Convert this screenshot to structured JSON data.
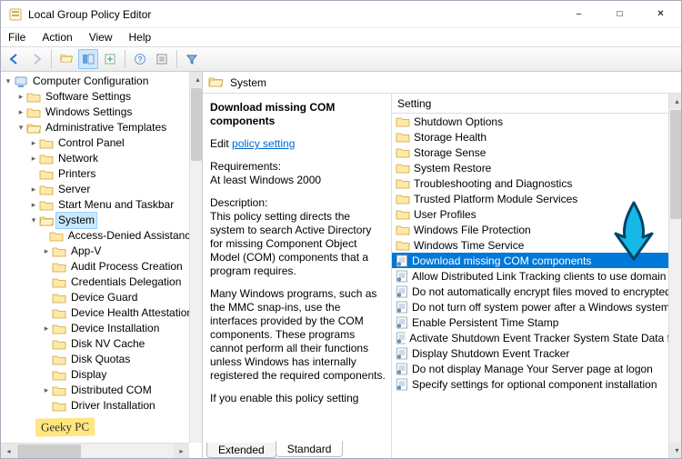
{
  "window": {
    "title": "Local Group Policy Editor"
  },
  "menubar": [
    "File",
    "Action",
    "View",
    "Help"
  ],
  "tree": {
    "root": "Computer Configuration",
    "children": [
      {
        "label": "Software Settings",
        "expand": "closed"
      },
      {
        "label": "Windows Settings",
        "expand": "closed"
      },
      {
        "label": "Administrative Templates",
        "expand": "open",
        "children": [
          {
            "label": "Control Panel",
            "expand": "closed"
          },
          {
            "label": "Network",
            "expand": "closed"
          },
          {
            "label": "Printers",
            "expand": "none"
          },
          {
            "label": "Server",
            "expand": "closed"
          },
          {
            "label": "Start Menu and Taskbar",
            "expand": "closed"
          },
          {
            "label": "System",
            "expand": "open",
            "selected": true,
            "children": [
              {
                "label": "Access-Denied Assistance"
              },
              {
                "label": "App-V",
                "expand": "closed"
              },
              {
                "label": "Audit Process Creation"
              },
              {
                "label": "Credentials Delegation"
              },
              {
                "label": "Device Guard"
              },
              {
                "label": "Device Health Attestation"
              },
              {
                "label": "Device Installation",
                "expand": "closed"
              },
              {
                "label": "Disk NV Cache"
              },
              {
                "label": "Disk Quotas"
              },
              {
                "label": "Display"
              },
              {
                "label": "Distributed COM",
                "expand": "closed"
              },
              {
                "label": "Driver Installation"
              }
            ]
          }
        ]
      }
    ]
  },
  "header": {
    "title": "System"
  },
  "detail": {
    "title": "Download missing COM components",
    "edit_prefix": "Edit ",
    "edit_link": "policy setting",
    "req_label": "Requirements:",
    "req_value": "At least Windows 2000",
    "desc_label": "Description:",
    "desc_p1": "This policy setting directs the system to search Active Directory for missing Component Object Model (COM) components that a program requires.",
    "desc_p2": "Many Windows programs, such as the MMC snap-ins, use the interfaces provided by the COM components. These programs cannot perform all their functions unless Windows has internally registered the required components.",
    "desc_p3": "If you enable this policy setting"
  },
  "list": {
    "column": "Setting",
    "items": [
      {
        "type": "folder",
        "label": "Shutdown Options"
      },
      {
        "type": "folder",
        "label": "Storage Health"
      },
      {
        "type": "folder",
        "label": "Storage Sense"
      },
      {
        "type": "folder",
        "label": "System Restore"
      },
      {
        "type": "folder",
        "label": "Troubleshooting and Diagnostics"
      },
      {
        "type": "folder",
        "label": "Trusted Platform Module Services"
      },
      {
        "type": "folder",
        "label": "User Profiles"
      },
      {
        "type": "folder",
        "label": "Windows File Protection"
      },
      {
        "type": "folder",
        "label": "Windows Time Service"
      },
      {
        "type": "setting",
        "label": "Download missing COM components",
        "selected": true
      },
      {
        "type": "setting",
        "label": "Allow Distributed Link Tracking clients to use domain"
      },
      {
        "type": "setting",
        "label": "Do not automatically encrypt files moved to encrypted"
      },
      {
        "type": "setting",
        "label": "Do not turn off system power after a Windows system"
      },
      {
        "type": "setting",
        "label": "Enable Persistent Time Stamp"
      },
      {
        "type": "setting",
        "label": "Activate Shutdown Event Tracker System State Data file"
      },
      {
        "type": "setting",
        "label": "Display Shutdown Event Tracker"
      },
      {
        "type": "setting",
        "label": "Do not display Manage Your Server page at logon"
      },
      {
        "type": "setting",
        "label": "Specify settings for optional component installation"
      }
    ]
  },
  "tabs": {
    "extended": "Extended",
    "standard": "Standard"
  },
  "watermark": "Geeky PC"
}
